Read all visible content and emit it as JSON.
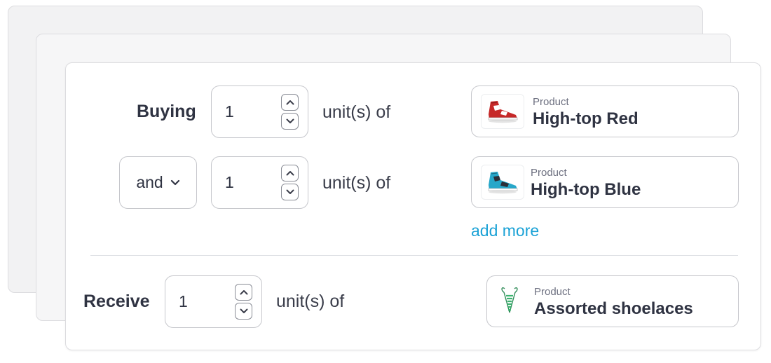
{
  "rules": [
    {
      "label": "Buying",
      "quantity": "1",
      "unit_text": "unit(s) of",
      "product": {
        "caption": "Product",
        "name": "High-top Red",
        "icon": "red-sneaker-icon"
      }
    },
    {
      "connector": "and",
      "quantity": "1",
      "unit_text": "unit(s) of",
      "product": {
        "caption": "Product",
        "name": "High-top Blue",
        "icon": "blue-sneaker-icon"
      }
    }
  ],
  "add_more_label": "add more",
  "receive": {
    "label": "Receive",
    "quantity": "1",
    "unit_text": "unit(s) of",
    "product": {
      "caption": "Product",
      "name": "Assorted shoelaces",
      "icon": "shoelaces-icon"
    }
  },
  "colors": {
    "text": "#2f3342",
    "muted": "#6d7080",
    "link": "#1ba2d6",
    "border": "#c6c7cc"
  }
}
